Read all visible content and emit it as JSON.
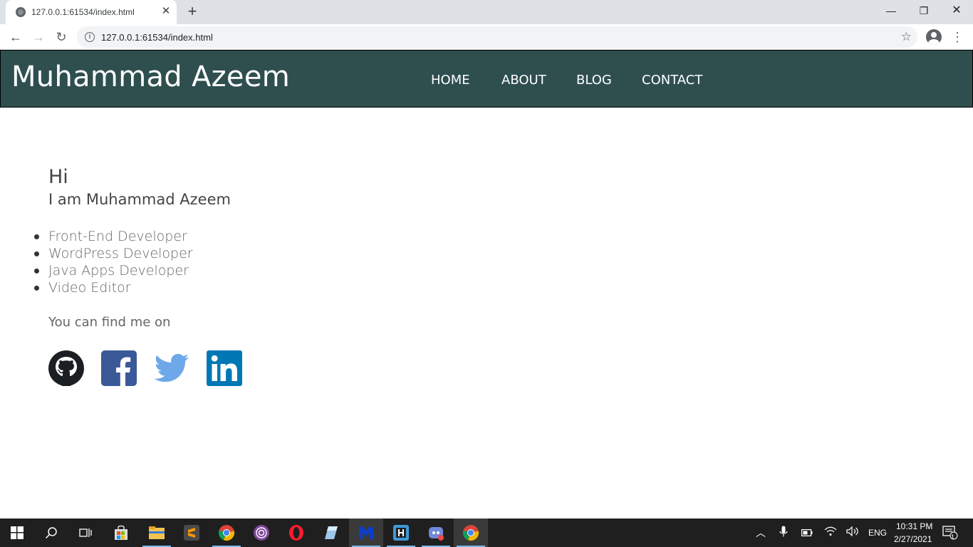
{
  "browser": {
    "tab_title": "127.0.0.1:61534/index.html",
    "url": "127.0.0.1:61534/index.html"
  },
  "site": {
    "brand": "Muhammad Azeem",
    "nav": [
      "HOME",
      "ABOUT",
      "BLOG",
      "CONTACT"
    ],
    "greeting": "Hi",
    "intro": "I am Muhammad Azeem",
    "roles": [
      "Front-End Developer",
      "WordPress Developer",
      "Java Apps Developer",
      "Video Editor"
    ],
    "find_me": "You can find me on",
    "social_icons": [
      "github-icon",
      "facebook-icon",
      "twitter-icon",
      "linkedin-icon"
    ]
  },
  "colors": {
    "header_bg": "#2f4f4f",
    "facebook": "#3b5998",
    "twitter": "#6fa8e8",
    "linkedin": "#0077b5"
  },
  "taskbar": {
    "language": "ENG",
    "time": "10:31 PM",
    "date": "2/27/2021",
    "notification_count": "1"
  }
}
